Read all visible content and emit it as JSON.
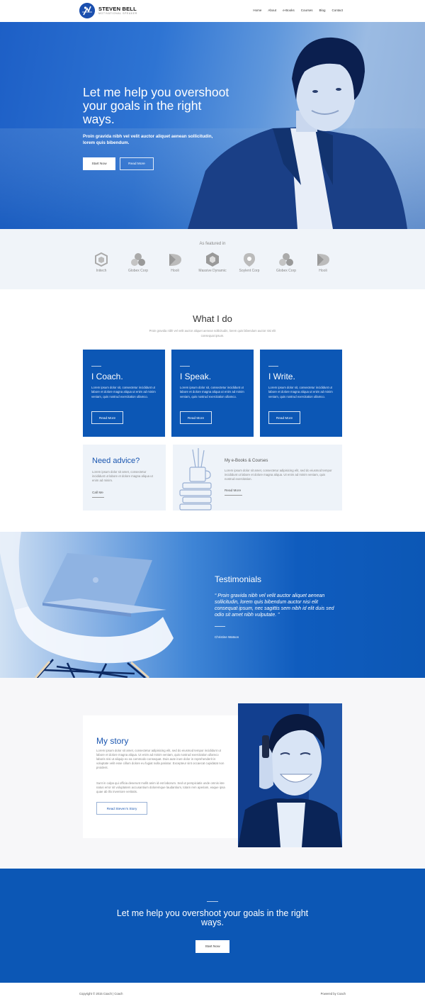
{
  "brand": {
    "name": "STEVEN BELL",
    "tagline": "MOTIVATIONAL SPEAKER"
  },
  "nav": [
    "Home",
    "About",
    "e-Books",
    "Courses",
    "Blog",
    "Contact"
  ],
  "hero": {
    "title": "Let me help you overshoot your goals in the right ways.",
    "subtitle": "Proin gravida nibh vel velit auctor aliquet aenean sollicitudin, lorem quis bibendum.",
    "primary_button": "Start Now",
    "secondary_button": "Read More"
  },
  "featured": {
    "title": "As featured in",
    "brands": [
      "Initech",
      "Globex Corp",
      "Hooli",
      "Massive Dynamic",
      "Soylent Corp",
      "Globex Corp",
      "Hooli"
    ]
  },
  "what_i_do": {
    "title": "What I do",
    "intro": "Proin gravida nibh vel velit auctor aliquet aenean sollicitudin, lorem quis bibendum auctor nisi elit consequat ipsum.",
    "cards": [
      {
        "title": "I Coach.",
        "text": "Lorem ipsum dolor sit, consectetur incididunt ut labore et dolore magna aliqua ut enim ad minim veniam, quis nostrud exercitation ullamco.",
        "button": "Read More"
      },
      {
        "title": "I Speak.",
        "text": "Lorem ipsum dolor sit, consectetur incididunt ut labore et dolore magna aliqua ut enim ad minim veniam, quis nostrud exercitation ullamco.",
        "button": "Read More"
      },
      {
        "title": "I Write.",
        "text": "Lorem ipsum dolor sit, consectetur incididunt ut labore et dolore magna aliqua ut enim ad minim veniam, quis nostrud exercitation ullamco.",
        "button": "Read More"
      }
    ],
    "advice": {
      "title": "Need advice?",
      "text": "Lorem ipsum dolor sit amet, consectetur incididunt ut labore et dolore magna aliqua ut enim ad minim.",
      "link": "Call Me"
    },
    "ebooks": {
      "title": "My e-Books & Courses",
      "text": "Lorem ipsum dolor sit amet, consectetur adipisicing elit, sed do eiusmod tempor incididunt ut labore et dolore magna aliqua. Ut enim ad minim veniam, quis nostrud exercitation.",
      "link": "Read More"
    }
  },
  "testimonials": {
    "title": "Testimonials",
    "quote": "“ Proin gravida nibh vel velit auctor aliquet aenean sollicitudin, lorem quis bibendum auctor nisi elit consequat ipsum, nec sagittis sem nibh id elit duis sed odio sit amet nibh vulputate. ”",
    "author": "Christine Watson"
  },
  "story": {
    "title": "My story",
    "paragraph1": "Lorem ipsum dolor sit amet, consectetur adipisicing elit, sed do eiusmod tempor incididunt ut labore et dolore magna aliqua. Ut enim ad minim veniam, quis nostrud exercitation ullamco laboris nisi ut aliquip ex ea commodo consequat. Duis aute irure dolor in reprehenderit in voluptate velit esse cillum dolore eu fugiat nulla pariatur. Excepteur sint occaecat cupidatat non proident.",
    "paragraph2": "Sunt in culpa qui officia deserunt mollit anim id est laborum. Sed ut perspiciatis unde omnis iste natus error sit voluptatem accusantium doloremque laudantium, totam rem aperiam, eaque ipsa quae ab illo inventore veritatis.",
    "button": "Read Steven's Story"
  },
  "cta": {
    "title": "Let me help you overshoot your goals in the right ways.",
    "button": "Start Now"
  },
  "footer": {
    "copyright": "Copyright © 2015 Coach | Coach",
    "powered": "Powered by Coach"
  },
  "colors": {
    "primary": "#0c57b5",
    "light_bg": "#eef3f9",
    "accent_text": "#1a56b0"
  }
}
